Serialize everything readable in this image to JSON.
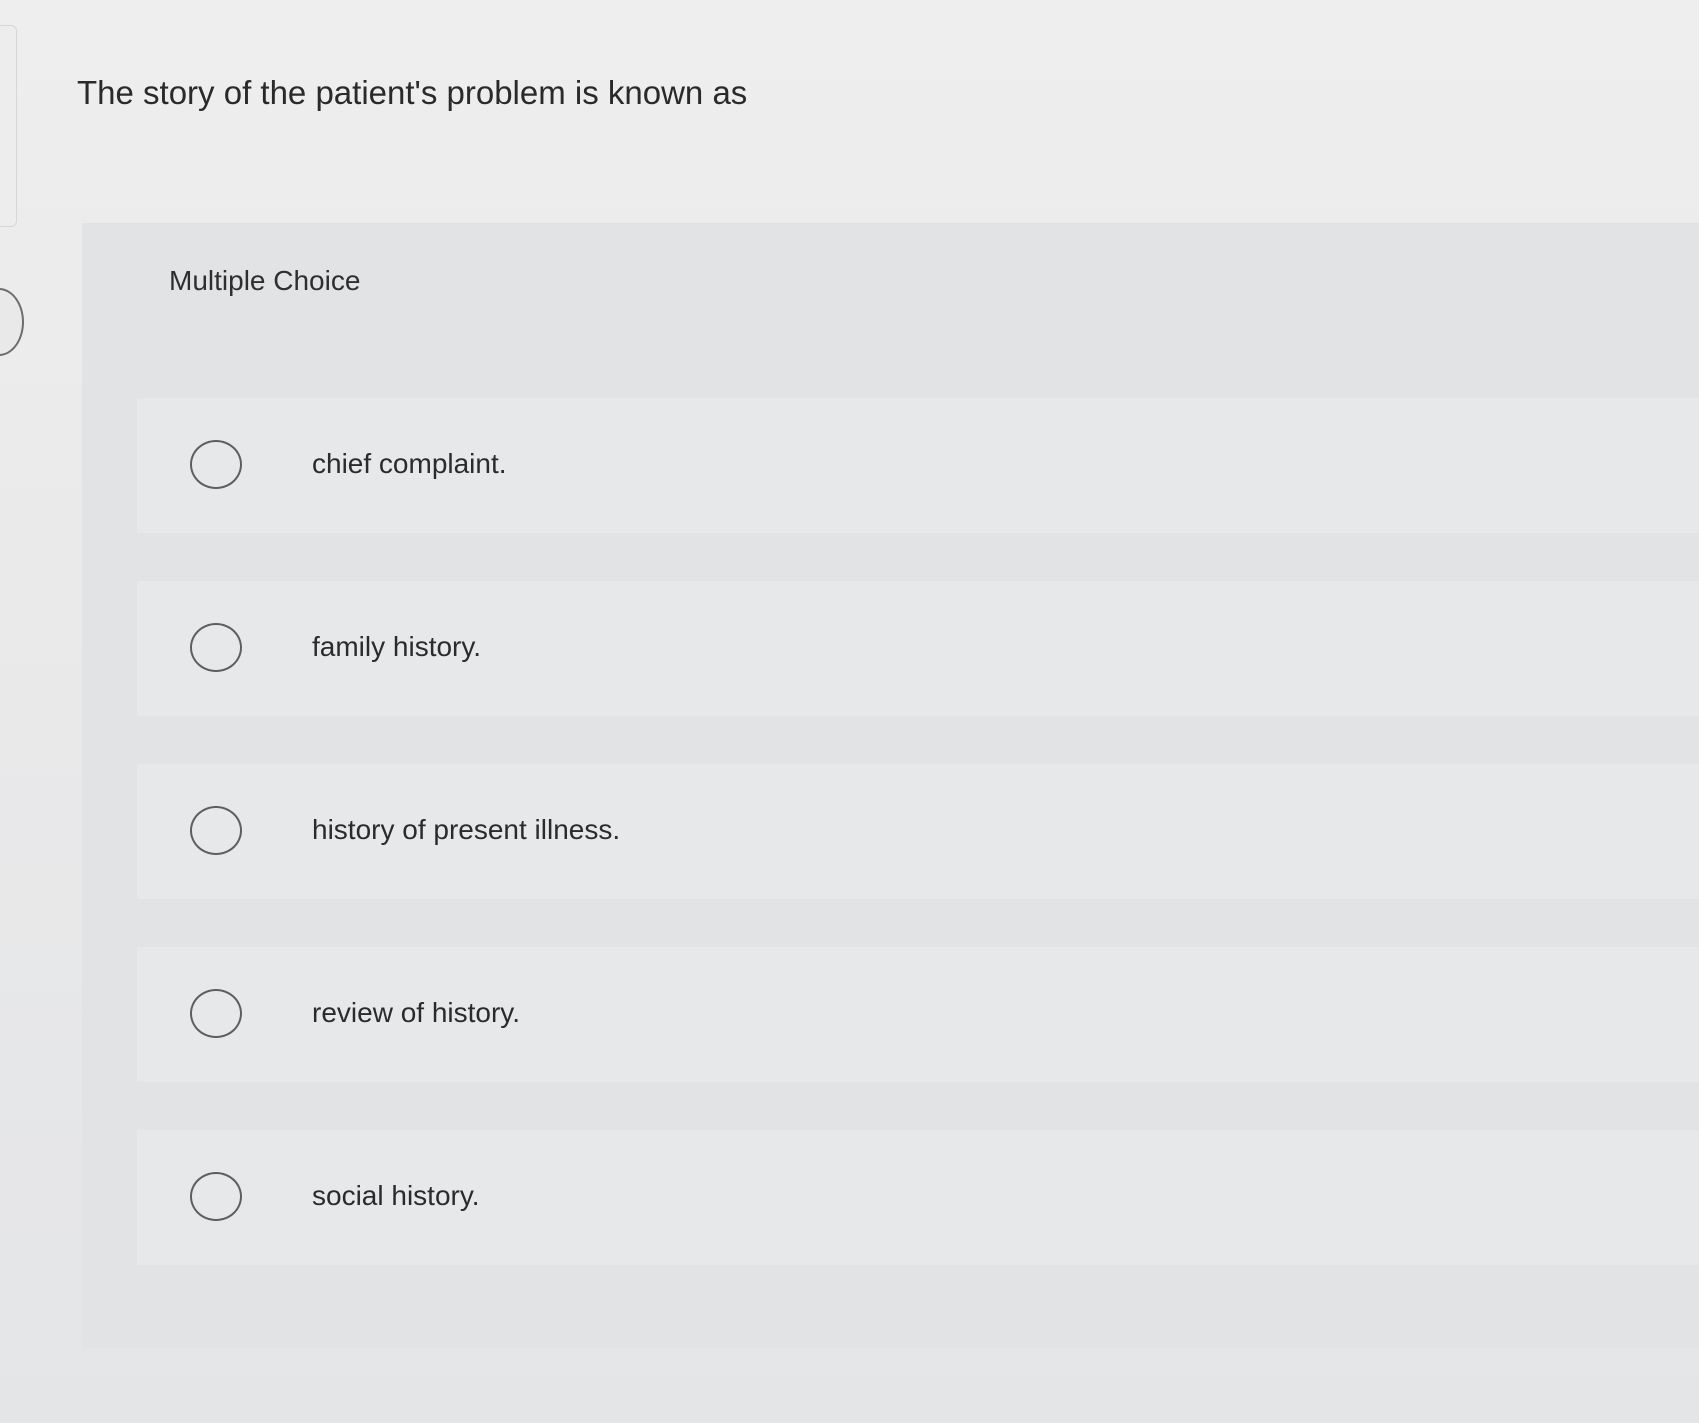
{
  "question": {
    "text": "The story of the patient's problem is known as",
    "type_label": "Multiple Choice",
    "options": [
      {
        "label": "chief complaint."
      },
      {
        "label": "family history."
      },
      {
        "label": "history of present illness."
      },
      {
        "label": "review of history."
      },
      {
        "label": "social history."
      }
    ]
  }
}
